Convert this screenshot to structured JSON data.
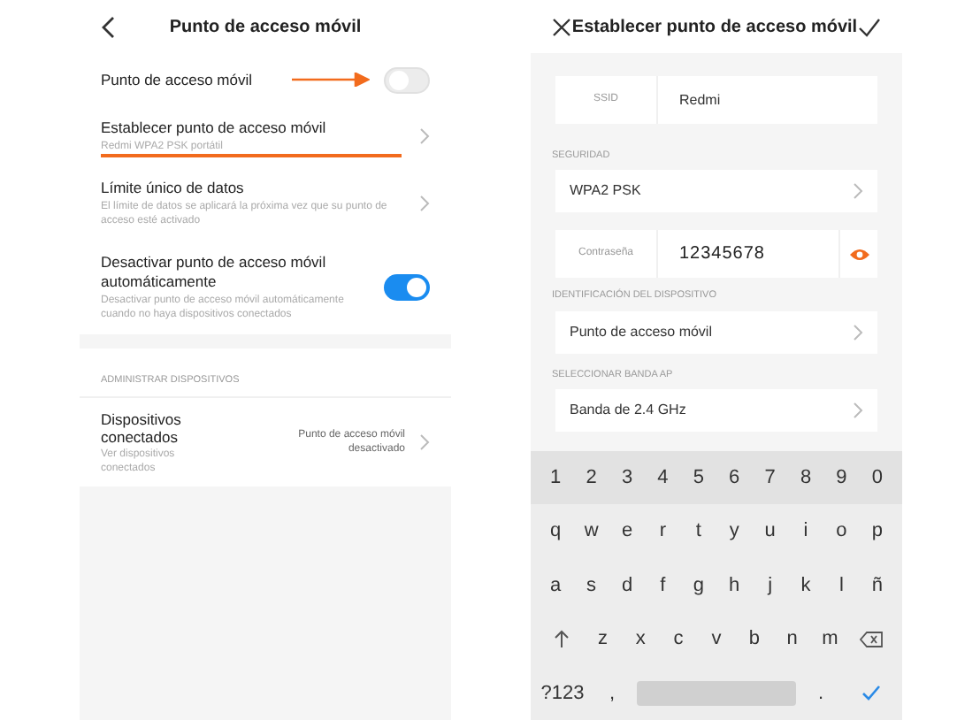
{
  "settings_screen": {
    "title": "Punto de acceso móvil",
    "items": [
      {
        "kind": "toggle",
        "title": "Punto de acceso móvil",
        "on": false,
        "highlighted": true
      },
      {
        "kind": "link",
        "title": "Establecer punto de acceso móvil",
        "subtitle": "Redmi WPA2 PSK portátil",
        "highlighted": true
      },
      {
        "kind": "link",
        "title": "Límite único de datos",
        "subtitle": "El límite de datos se aplicará la próxima vez que su punto de acceso esté activado",
        "highlighted": false
      },
      {
        "kind": "toggle",
        "title": "Desactivar punto de acceso móvil automáticamente",
        "subtitle": "Desactivar punto de acceso móvil automáticamente cuando no haya dispositivos conectados",
        "on": true,
        "highlighted": false
      }
    ],
    "section_label": "ADMINISTRAR DISPOSITIVOS",
    "devices": {
      "title": "Dispositivos conectados",
      "subtitle": "Ver dispositivos conectados",
      "value": "Punto de acceso móvil desactivado"
    }
  },
  "config_screen": {
    "title": "Establecer punto de acceso móvil",
    "fields": [
      {
        "kind": "input",
        "label": "SSID",
        "value": "Redmi"
      },
      {
        "kind": "section",
        "label": "SEGURIDAD"
      },
      {
        "kind": "select",
        "value": "WPA2 PSK"
      },
      {
        "kind": "password",
        "label": "Contraseña",
        "value": "12345678",
        "visible": true
      },
      {
        "kind": "section",
        "label": "IDENTIFICACIÓN DEL DISPOSITIVO"
      },
      {
        "kind": "select",
        "value": "Punto de acceso móvil"
      },
      {
        "kind": "section",
        "label": "SELECCIONAR BANDA AP"
      },
      {
        "kind": "select",
        "value": "Banda de 2.4 GHz"
      }
    ]
  },
  "keyboard": {
    "rows": [
      [
        {
          "kind": "char",
          "label": "1"
        },
        {
          "kind": "char",
          "label": "2"
        },
        {
          "kind": "char",
          "label": "3"
        },
        {
          "kind": "char",
          "label": "4"
        },
        {
          "kind": "char",
          "label": "5"
        },
        {
          "kind": "char",
          "label": "6"
        },
        {
          "kind": "char",
          "label": "7"
        },
        {
          "kind": "char",
          "label": "8"
        },
        {
          "kind": "char",
          "label": "9"
        },
        {
          "kind": "char",
          "label": "0"
        }
      ],
      [
        {
          "kind": "char",
          "label": "q"
        },
        {
          "kind": "char",
          "label": "w"
        },
        {
          "kind": "char",
          "label": "e"
        },
        {
          "kind": "char",
          "label": "r"
        },
        {
          "kind": "char",
          "label": "t"
        },
        {
          "kind": "char",
          "label": "y"
        },
        {
          "kind": "char",
          "label": "u"
        },
        {
          "kind": "char",
          "label": "i"
        },
        {
          "kind": "char",
          "label": "o"
        },
        {
          "kind": "char",
          "label": "p"
        }
      ],
      [
        {
          "kind": "char",
          "label": "a"
        },
        {
          "kind": "char",
          "label": "s"
        },
        {
          "kind": "char",
          "label": "d"
        },
        {
          "kind": "char",
          "label": "f"
        },
        {
          "kind": "char",
          "label": "g"
        },
        {
          "kind": "char",
          "label": "h"
        },
        {
          "kind": "char",
          "label": "j"
        },
        {
          "kind": "char",
          "label": "k"
        },
        {
          "kind": "char",
          "label": "l"
        },
        {
          "kind": "char",
          "label": "ñ"
        }
      ],
      [
        {
          "kind": "shift"
        },
        {
          "kind": "char",
          "label": "z"
        },
        {
          "kind": "char",
          "label": "x"
        },
        {
          "kind": "char",
          "label": "c"
        },
        {
          "kind": "char",
          "label": "v"
        },
        {
          "kind": "char",
          "label": "b"
        },
        {
          "kind": "char",
          "label": "n"
        },
        {
          "kind": "char",
          "label": "m"
        },
        {
          "kind": "backspace"
        }
      ],
      [
        {
          "kind": "char",
          "label": "?123"
        },
        {
          "kind": "char",
          "label": ","
        },
        {
          "kind": "space"
        },
        {
          "kind": "char",
          "label": "."
        },
        {
          "kind": "enter"
        }
      ]
    ]
  }
}
